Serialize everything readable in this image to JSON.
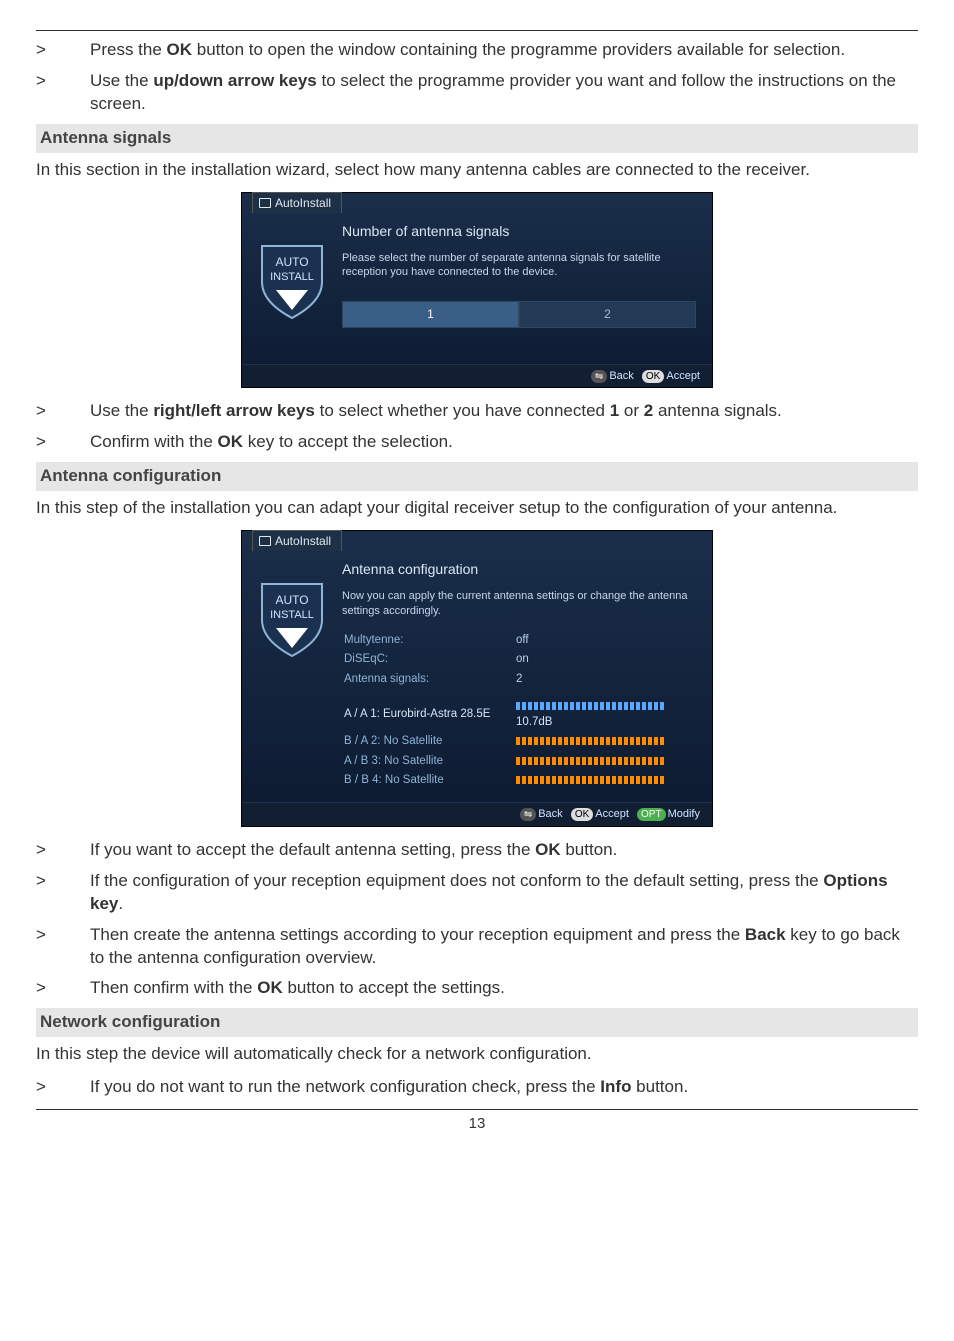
{
  "bullets_top": [
    {
      "sym": ">",
      "pre": "Press the ",
      "bold": "OK",
      "post": " button to open the window containing the programme providers available for selection."
    },
    {
      "sym": ">",
      "pre": "Use the ",
      "bold": "up/down arrow keys",
      "post": " to select the programme provider you want and follow the instructions on the screen."
    }
  ],
  "antenna_signals": {
    "heading": "Antenna signals",
    "intro": "In this section in the installation wizard, select how many antenna cables are connected to the receiver.",
    "fig": {
      "tab": "AutoInstall",
      "title": "Number of antenna signals",
      "desc": "Please select the number of separate antenna signals for satellite reception you have connected to the device.",
      "opt1": "1",
      "opt2": "2",
      "footer_back": "Back",
      "footer_accept": "Accept"
    },
    "after": [
      {
        "sym": ">",
        "pre": "Use the ",
        "bold": "right/left arrow keys",
        "mid": " to select whether you have connected ",
        "bold2": "1",
        "mid2": " or ",
        "bold3": "2",
        "post": " antenna signals."
      },
      {
        "sym": ">",
        "pre": "Confirm with the ",
        "bold": "OK",
        "post": " key to accept the selection."
      }
    ]
  },
  "antenna_config": {
    "heading": "Antenna configuration",
    "intro": "In this step of the installation you can adapt your digital receiver setup to the configuration of your antenna.",
    "fig": {
      "tab": "AutoInstall",
      "title": "Antenna configuration",
      "desc": "Now you can apply the current antenna settings or change the antenna settings accordingly.",
      "rows": [
        {
          "k": "Multytenne:",
          "v": "off"
        },
        {
          "k": "DiSEqC:",
          "v": "on"
        },
        {
          "k": "Antenna signals:",
          "v": "2"
        }
      ],
      "sat_rows": [
        {
          "label": "A / A  1: Eurobird-Astra 28.5E",
          "db": "10.7dB",
          "first": true
        },
        {
          "label": "B / A  2: No Satellite"
        },
        {
          "label": "A / B  3: No Satellite"
        },
        {
          "label": "B / B  4: No Satellite"
        }
      ],
      "footer_back": "Back",
      "footer_accept": "Accept",
      "footer_modify": "Modify"
    },
    "after": [
      {
        "sym": ">",
        "pre": "If you want to accept the default antenna setting, press the ",
        "bold": "OK",
        "post": " button."
      },
      {
        "sym": ">",
        "pre": "If the configuration of your reception equipment does not conform to the default setting, press the ",
        "bold": "Options key",
        "post": "."
      },
      {
        "sym": ">",
        "pre": "Then create the antenna settings according to your reception equipment and press the ",
        "bold": "Back",
        "post": " key to go back to the antenna configuration overview."
      },
      {
        "sym": ">",
        "pre": "Then confirm with the ",
        "bold": "OK",
        "post": " button to accept the settings."
      }
    ]
  },
  "network_config": {
    "heading": "Network configuration",
    "intro": "In this step the device will automatically check for a network configuration.",
    "after": [
      {
        "sym": ">",
        "pre": "If you do not want to run the network configuration check, press the ",
        "bold": "Info",
        "post": " button."
      }
    ]
  },
  "shield": {
    "line1": "AUTO",
    "line2": "INSTALL"
  },
  "page": "13"
}
